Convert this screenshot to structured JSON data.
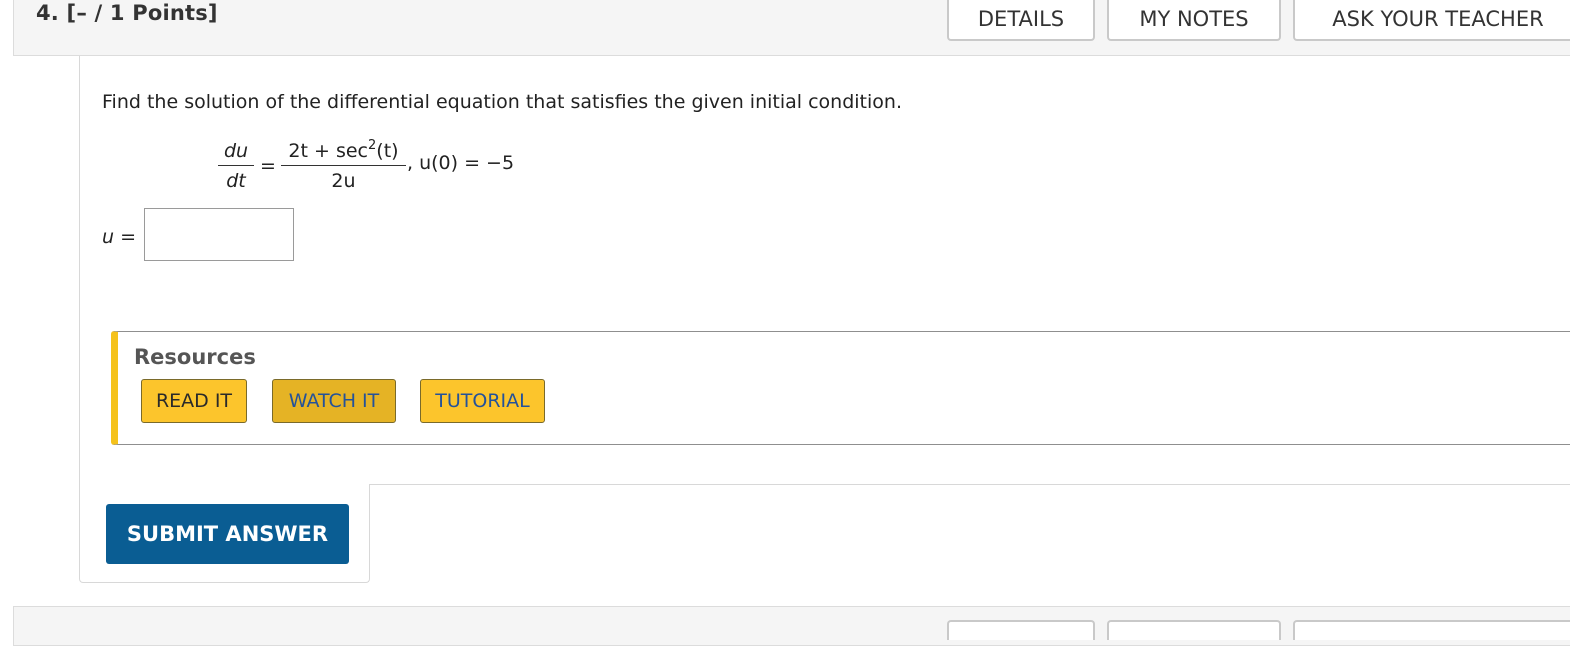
{
  "question": {
    "number_label": "4.",
    "points_label": "[– / 1 Points]"
  },
  "header_buttons": {
    "details": "DETAILS",
    "my_notes": "MY NOTES",
    "ask_teacher": "ASK YOUR TEACHER"
  },
  "prompt": "Find the solution of the differential equation that satisfies the given initial condition.",
  "equation": {
    "left_num": "du",
    "left_den": "dt",
    "equals": "=",
    "right_num_a": "2t + sec",
    "right_num_exp": "2",
    "right_num_b": "(t)",
    "right_den": "2u",
    "condition": ", u(0) = −5"
  },
  "answer": {
    "label": "u =",
    "value": ""
  },
  "resources": {
    "title": "Resources",
    "buttons": [
      "READ IT",
      "WATCH IT",
      "TUTORIAL"
    ]
  },
  "submit_label": "SUBMIT ANSWER"
}
